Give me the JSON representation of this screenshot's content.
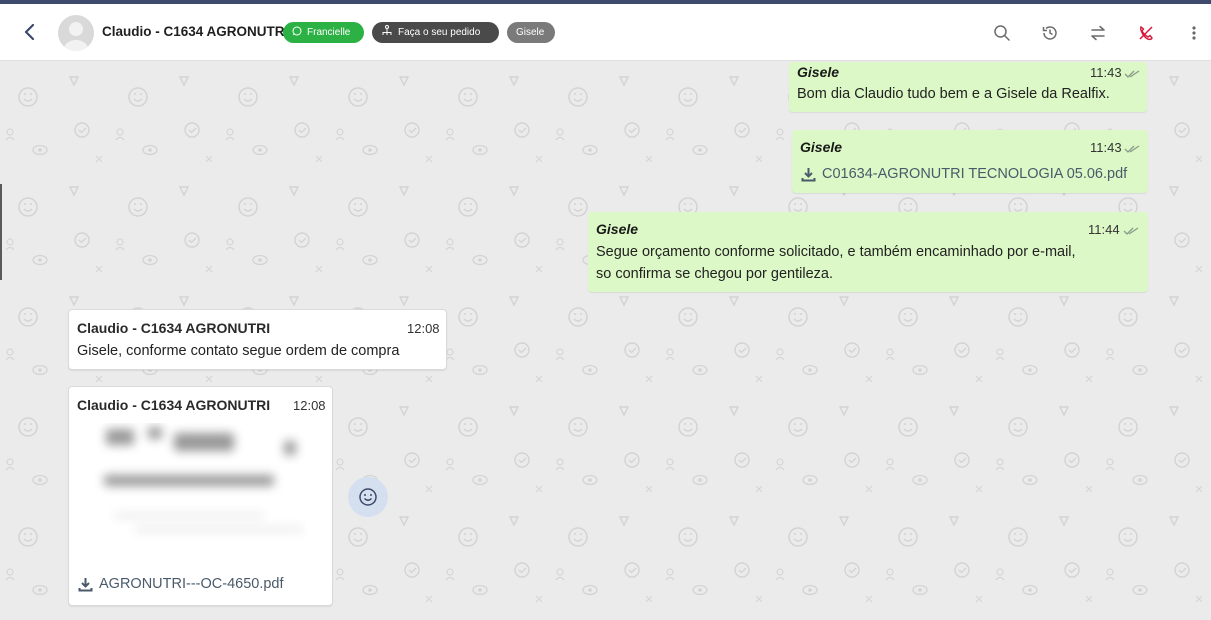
{
  "header": {
    "contact_name": "Claudio - C1634 AGRONUTRI",
    "tags": [
      {
        "label": "Francielle",
        "icon": "whatsapp-icon",
        "color": "#2cb144"
      },
      {
        "label": "Faça o seu pedido",
        "icon": "flow-icon",
        "color": "#4a4a4a"
      },
      {
        "label": "Gisele",
        "icon": "",
        "color": "#7a7a7a"
      }
    ],
    "actions": [
      "search-icon",
      "history-icon",
      "transfer-icon",
      "end-call-icon",
      "more-icon"
    ],
    "accent_red": "#d6173a"
  },
  "messages": [
    {
      "direction": "out",
      "sender": "Gisele",
      "time": "11:43",
      "text": "Bom dia Claudio tudo bem e a Gisele da Realfix."
    },
    {
      "direction": "out",
      "sender": "Gisele",
      "time": "11:43",
      "file": "C01634-AGRONUTRI TECNOLOGIA 05.06.pdf"
    },
    {
      "direction": "out",
      "sender": "Gisele",
      "time": "11:44",
      "lines": [
        "Segue orçamento conforme solicitado, e também encaminhado por e-mail,",
        "so confirma se chegou por gentileza."
      ]
    },
    {
      "direction": "in",
      "sender": "Claudio - C1634 AGRONUTRI",
      "time": "12:08",
      "text": "Gisele, conforme contato segue ordem de compra"
    },
    {
      "direction": "in",
      "sender": "Claudio - C1634 AGRONUTRI",
      "time": "12:08",
      "file": "AGRONUTRI---OC-4650.pdf"
    }
  ],
  "colors": {
    "outgoing_bubble": "#dcf8c6",
    "incoming_bubble": "#ffffff",
    "chat_background": "#ebebeb"
  }
}
